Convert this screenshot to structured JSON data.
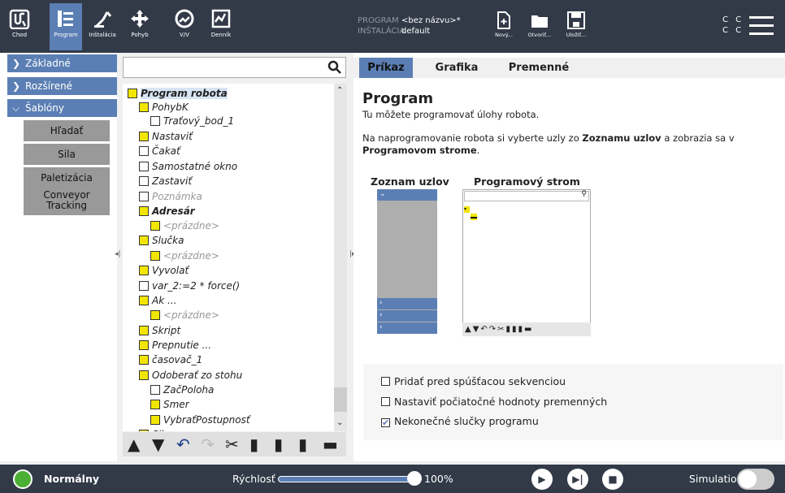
{
  "header": {
    "nav": [
      {
        "label": "Chod",
        "icon": "ur-logo-icon"
      },
      {
        "label": "Program",
        "icon": "program-tree-icon"
      },
      {
        "label": "Inštalácia",
        "icon": "installation-icon"
      },
      {
        "label": "Pohyb",
        "icon": "move-icon"
      },
      {
        "label": "V/V",
        "icon": "io-icon"
      },
      {
        "label": "Denník",
        "icon": "log-icon"
      }
    ],
    "program_key": "PROGRAM",
    "program_val": "<bez názvu>*",
    "install_key": "INŠTALÁCIA",
    "install_val": "default",
    "file_btns": [
      {
        "label": "Nový...",
        "icon": "new-file-icon"
      },
      {
        "label": "Otvoriť...",
        "icon": "open-folder-icon"
      },
      {
        "label": "Uložiť...",
        "icon": "save-icon"
      }
    ],
    "cc1": "C C",
    "cc2": "C C"
  },
  "left": {
    "categories": [
      {
        "label": "Základné",
        "chev": "›"
      },
      {
        "label": "Rozšírené",
        "chev": "›"
      },
      {
        "label": "Šablóny",
        "chev": "⌄"
      }
    ],
    "templates": [
      {
        "label": "Hľadať"
      },
      {
        "label": "Sila"
      },
      {
        "label": "Paletizácia"
      },
      {
        "label": "Conveyor Tracking"
      }
    ]
  },
  "tree": {
    "nodes": [
      {
        "label": "Program robota",
        "icon": "program-root-icon"
      },
      {
        "label": "PohybK",
        "icon": "move-node-icon"
      },
      {
        "label": "Traťový_bod_1",
        "icon": "waypoint-icon"
      },
      {
        "label": "Nastaviť",
        "icon": "set-icon"
      },
      {
        "label": "Čakať",
        "icon": "wait-icon"
      },
      {
        "label": "Samostatné okno",
        "icon": "popup-icon"
      },
      {
        "label": "Zastaviť",
        "icon": "halt-icon"
      },
      {
        "label": "Poznámka",
        "icon": "comment-icon"
      },
      {
        "label": "Adresár",
        "icon": "folder-icon"
      },
      {
        "label": "<prázdne>",
        "icon": "empty-icon"
      },
      {
        "label": "Slučka",
        "icon": "loop-icon"
      },
      {
        "label": "<prázdne>",
        "icon": "empty-icon"
      },
      {
        "label": "Vyvolať",
        "icon": "call-icon"
      },
      {
        "label": "var_2:=2 * force()",
        "icon": "assignment-icon"
      },
      {
        "label": "Ak ...",
        "icon": "if-icon"
      },
      {
        "label": "<prázdne>",
        "icon": "empty-icon"
      },
      {
        "label": "Skript",
        "icon": "script-icon"
      },
      {
        "label": "Prepnutie ...",
        "icon": "switch-icon"
      },
      {
        "label": "časovač_1",
        "icon": "timer-icon"
      },
      {
        "label": "Odoberať zo stohu",
        "icon": "destack-icon"
      },
      {
        "label": "ZačPoloha",
        "icon": "waypoint-icon"
      },
      {
        "label": "Smer",
        "icon": "direction-icon"
      },
      {
        "label": "VybraťPostupnosť",
        "icon": "direction-icon"
      },
      {
        "label": "Sila",
        "icon": "force-icon"
      }
    ],
    "tools": [
      "▲",
      "▼",
      "↶",
      "↷",
      "✂",
      "▮",
      "▮",
      "▮",
      "▬"
    ]
  },
  "right": {
    "tabs": [
      "Príkaz",
      "Grafika",
      "Premenné"
    ],
    "title": "Program",
    "desc1": "Tu môžete programovať úlohy robota.",
    "desc2_a": "Na naprogramovanie robota si vyberte uzly zo ",
    "desc2_b": "Zoznamu uzlov",
    "desc2_c": " a zobrazia sa v ",
    "desc2_d": "Programovom strome",
    "desc2_e": ".",
    "zoznam_title": "Zoznam uzlov",
    "strom_title": "Programový strom",
    "options": [
      {
        "label": "Pridať pred spúšťacou sekvenciou",
        "checked": false
      },
      {
        "label": "Nastaviť počiatočné hodnoty premenných",
        "checked": false
      },
      {
        "label": "Nekonečné slučky programu",
        "checked": true
      }
    ]
  },
  "footer": {
    "state": "Normálny",
    "speed_label": "Rýchlosť",
    "speed_value": "100%",
    "speed_fraction": 1.0,
    "sim_label": "Simulation"
  },
  "colors": {
    "header": "#323a48",
    "accent": "#5b7fb4",
    "power": "#4caf35"
  }
}
